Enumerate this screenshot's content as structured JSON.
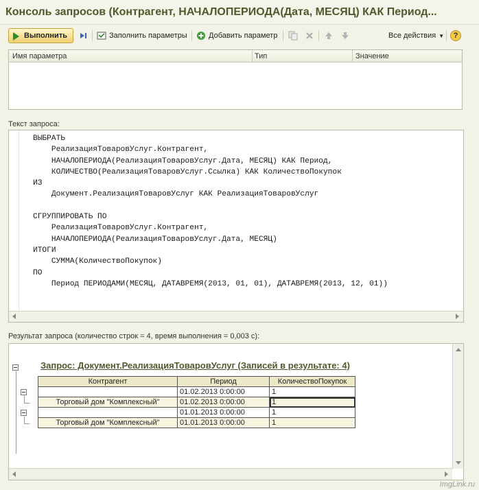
{
  "window": {
    "title": "Консоль запросов (Контрагент, НАЧАЛОПЕРИОДА(Дата, МЕСЯЦ) КАК Период..."
  },
  "toolbar": {
    "run_label": "Выполнить",
    "fill_params_label": "Заполнить параметры",
    "add_param_label": "Добавить параметр",
    "all_actions_label": "Все действия",
    "help_label": "?"
  },
  "params_table": {
    "columns": [
      "Имя параметра",
      "Тип",
      "Значение"
    ]
  },
  "query": {
    "label": "Текст запроса:",
    "text": "ВЫБРАТЬ\n    РеализацияТоваровУслуг.Контрагент,\n    НАЧАЛОПЕРИОДА(РеализацияТоваровУслуг.Дата, МЕСЯЦ) КАК Период,\n    КОЛИЧЕСТВО(РеализацияТоваровУслуг.Ссылка) КАК КоличествоПокупок\nИЗ\n    Документ.РеализацияТоваровУслуг КАК РеализацияТоваровУслуг\n\nСГРУППИРОВАТЬ ПО\n    РеализацияТоваровУслуг.Контрагент,\n    НАЧАЛОПЕРИОДА(РеализацияТоваровУслуг.Дата, МЕСЯЦ)\nИТОГИ\n    СУММА(КоличествоПокупок)\nПО\n    Период ПЕРИОДАМИ(МЕСЯЦ, ДАТАВРЕМЯ(2013, 01, 01), ДАТАВРЕМЯ(2013, 12, 01))"
  },
  "result": {
    "label": "Результат запроса (количество строк = 4, время выполнения = 0,003 с):",
    "title": "Запрос: Документ.РеализацияТоваровУслуг (Записей в результате: 4)",
    "columns": [
      "Контрагент",
      "Период",
      "КоличествоПокупок"
    ],
    "rows": [
      [
        "",
        "01.02.2013 0:00:00",
        "1"
      ],
      [
        "Торговый дом \"Комплексный\"",
        "01.02.2013 0:00:00",
        "1"
      ],
      [
        "",
        "01.01.2013 0:00:00",
        "1"
      ],
      [
        "Торговый дом \"Комплексный\"",
        "01.01.2013 0:00:00",
        "1"
      ]
    ]
  },
  "watermark": "ImgLink.ru"
}
